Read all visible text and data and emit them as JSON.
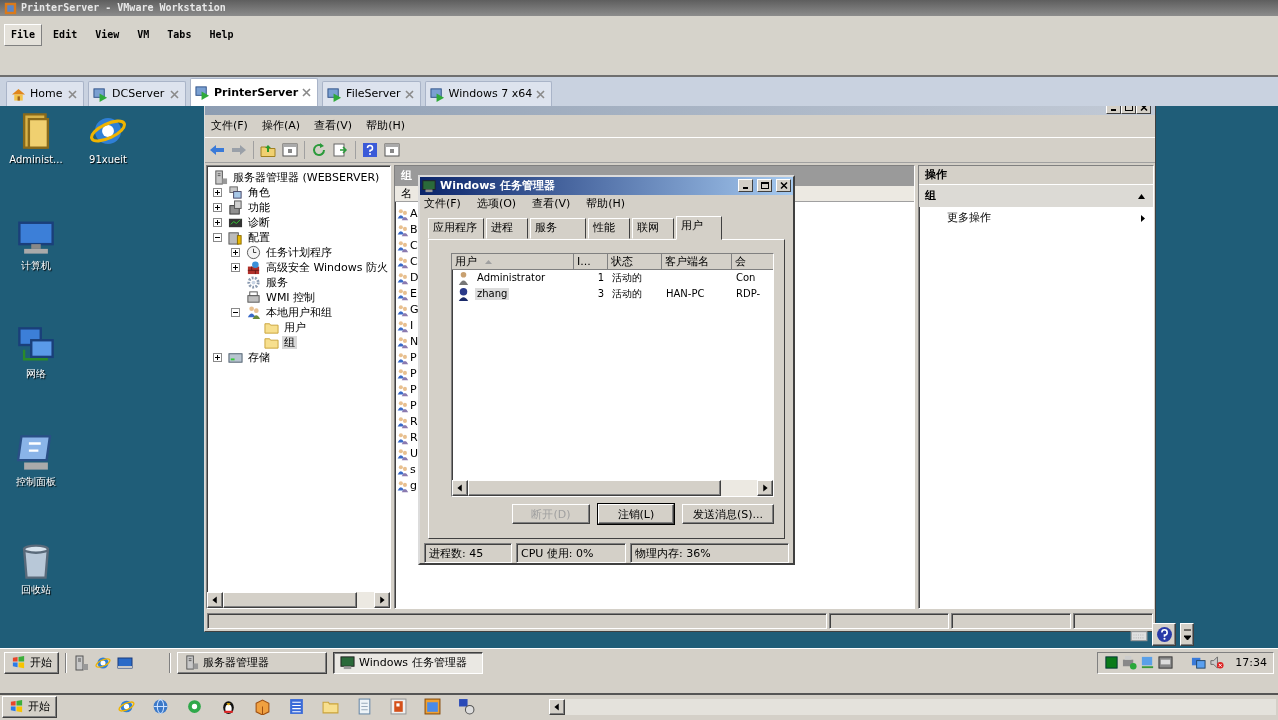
{
  "vmware_window": {
    "title": "PrinterServer - VMware Workstation"
  },
  "vmware_menu": [
    {
      "label": "File",
      "selected": true
    },
    {
      "label": "Edit",
      "selected": false
    },
    {
      "label": "View",
      "selected": false
    },
    {
      "label": "VM",
      "selected": false
    },
    {
      "label": "Tabs",
      "selected": false
    },
    {
      "label": "Help",
      "selected": false
    }
  ],
  "vm_tabs": [
    {
      "label": "Home",
      "kind": "home",
      "selected": false
    },
    {
      "label": "DCServer",
      "kind": "vm",
      "selected": false
    },
    {
      "label": "PrinterServer",
      "kind": "vm",
      "selected": true
    },
    {
      "label": "FileServer",
      "kind": "vm",
      "selected": false
    },
    {
      "label": "Windows 7 x64",
      "kind": "vm",
      "selected": false
    }
  ],
  "desktop_icons": [
    {
      "label": "Administ...",
      "kind": "userfolder"
    },
    {
      "label": "91xueit",
      "kind": "browser"
    },
    {
      "label": "计算机",
      "kind": "computer"
    },
    {
      "label": "网络",
      "kind": "network"
    },
    {
      "label": "控制面板",
      "kind": "control"
    },
    {
      "label": "回收站",
      "kind": "recycle"
    }
  ],
  "server_manager": {
    "menu": [
      "文件(F)",
      "操作(A)",
      "查看(V)",
      "帮助(H)"
    ],
    "tree": [
      {
        "label": "服务器管理器 (WEBSERVER)",
        "kind": "server",
        "selected": false,
        "children": [
          {
            "label": "角色",
            "kind": "roles",
            "expanded": false,
            "selected": false
          },
          {
            "label": "功能",
            "kind": "features",
            "expanded": false,
            "selected": false
          },
          {
            "label": "诊断",
            "kind": "diag",
            "expanded": false,
            "selected": false
          },
          {
            "label": "配置",
            "kind": "config",
            "expanded": true,
            "selected": false,
            "children": [
              {
                "label": "任务计划程序",
                "kind": "clock",
                "expanded": false,
                "selected": false
              },
              {
                "label": "高级安全 Windows 防火",
                "kind": "firewall",
                "expanded": false,
                "selected": false
              },
              {
                "label": "服务",
                "kind": "gear",
                "selected": false
              },
              {
                "label": "WMI 控制",
                "kind": "wmi",
                "selected": false
              },
              {
                "label": "本地用户和组",
                "kind": "users",
                "expanded": true,
                "selected": false,
                "children": [
                  {
                    "label": "用户",
                    "kind": "folder",
                    "selected": false
                  },
                  {
                    "label": "组",
                    "kind": "folder",
                    "selected": true
                  }
                ]
              }
            ]
          },
          {
            "label": "存储",
            "kind": "storage",
            "expanded": false,
            "selected": false
          }
        ]
      }
    ],
    "groups_pane": {
      "title": "组",
      "column": "名",
      "rows": [
        "A",
        "B",
        "C",
        "C",
        "D",
        "E",
        "G",
        "I",
        "N",
        "P",
        "P",
        "P",
        "P",
        "R",
        "R",
        "U",
        "s",
        "g"
      ]
    },
    "actions_pane": {
      "title": "操作",
      "section": "组",
      "expanded": true,
      "items": [
        "更多操作"
      ]
    }
  },
  "task_manager": {
    "title": "Windows 任务管理器",
    "menu": [
      "文件(F)",
      "选项(O)",
      "查看(V)",
      "帮助(H)"
    ],
    "tabs": [
      {
        "label": "应用程序",
        "selected": false
      },
      {
        "label": "进程",
        "selected": false
      },
      {
        "label": "服务",
        "selected": false
      },
      {
        "label": "性能",
        "selected": false
      },
      {
        "label": "联网",
        "selected": false
      },
      {
        "label": "用户",
        "selected": true
      }
    ],
    "columns": [
      {
        "label": "用户",
        "sorted": true
      },
      {
        "label": "I...",
        "sorted": false
      },
      {
        "label": "状态",
        "sorted": false
      },
      {
        "label": "客户端名",
        "sorted": false
      },
      {
        "label": "会",
        "sorted": false
      }
    ],
    "rows": [
      {
        "user": "Administrator",
        "kind": "admin",
        "id": "1",
        "status": "活动的",
        "session": "Con",
        "selected": false
      },
      {
        "user": "zhang",
        "kind": "user",
        "id": "3",
        "status": "活动的",
        "client": "HAN-PC",
        "session": "RDP-",
        "selected": true
      }
    ],
    "buttons": [
      {
        "label": "断开(D)",
        "disabled": true,
        "default": false
      },
      {
        "label": "注销(L)",
        "disabled": false,
        "default": true
      },
      {
        "label": "发送消息(S)...",
        "disabled": false,
        "default": false
      }
    ],
    "status": [
      "进程数: 45",
      "CPU 使用: 0%",
      "物理内存: 36%"
    ]
  },
  "guest_taskbar": {
    "start": "开始",
    "tasks": [
      {
        "label": "服务器管理器",
        "kind": "server",
        "selected": false
      },
      {
        "label": "Windows 任务管理器",
        "kind": "taskmgr",
        "selected": true
      }
    ],
    "clock": "17:34"
  },
  "host_taskbar": {
    "start": "开始"
  }
}
